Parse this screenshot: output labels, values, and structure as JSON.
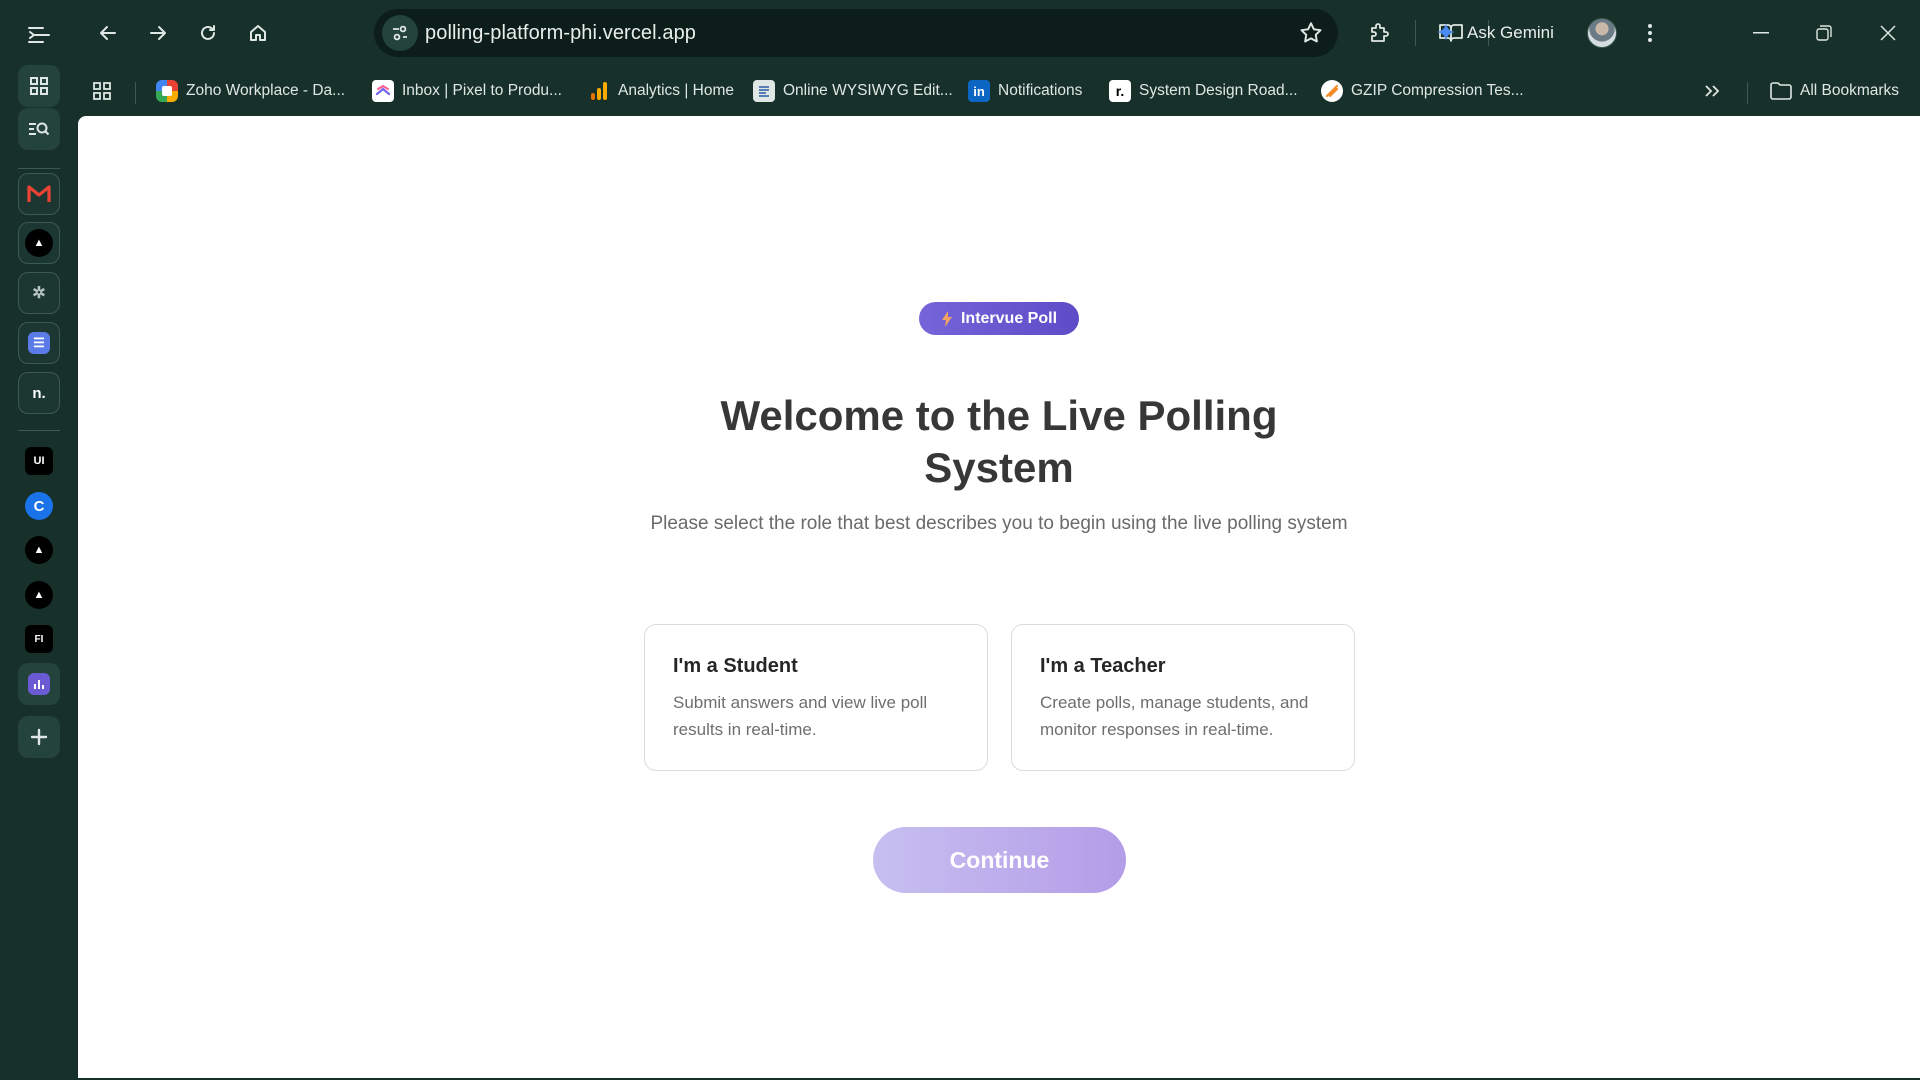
{
  "browser": {
    "url": "polling-platform-phi.vercel.app",
    "ask_gemini_label": "Ask Gemini",
    "all_bookmarks_label": "All Bookmarks",
    "bookmarks": [
      {
        "label": "Zoho Workplace - Da...",
        "icon": "zoho-icon"
      },
      {
        "label": "Inbox | Pixel to Produ...",
        "icon": "clickup-icon"
      },
      {
        "label": "Analytics | Home",
        "icon": "analytics-icon"
      },
      {
        "label": "Online WYSIWYG Edit...",
        "icon": "document-icon"
      },
      {
        "label": "Notifications",
        "icon": "linkedin-icon"
      },
      {
        "label": "System Design Road...",
        "icon": "roadmap-icon"
      },
      {
        "label": "GZIP Compression Tes...",
        "icon": "gzip-icon"
      }
    ]
  },
  "sidebar": {
    "apps": [
      {
        "name": "gmail-icon",
        "glyph": "M"
      },
      {
        "name": "triangle-app-icon",
        "glyph": "▲"
      },
      {
        "name": "spark-app-icon",
        "glyph": "✲"
      },
      {
        "name": "list-app-icon",
        "glyph": "☰"
      },
      {
        "name": "notion-style-app-icon",
        "glyph": "n."
      },
      {
        "name": "ui-app-icon",
        "glyph": "UI"
      },
      {
        "name": "c-app-icon",
        "glyph": "C"
      },
      {
        "name": "triangle-app-icon-2",
        "glyph": "▲"
      },
      {
        "name": "triangle-app-icon-3",
        "glyph": "▲"
      },
      {
        "name": "fi-app-icon",
        "glyph": "FI"
      },
      {
        "name": "bar-chart-app-icon",
        "glyph": "▮"
      }
    ]
  },
  "page": {
    "badge_label": "Intervue Poll",
    "title_prefix": "Welcome to the ",
    "title_bold": "Live Polling System",
    "subtitle": "Please select the role that best describes you to begin using the live polling system",
    "roles": [
      {
        "title": "I'm a Student",
        "description": "Submit answers and view live poll results in real-time."
      },
      {
        "title": "I'm a Teacher",
        "description": "Create polls, manage students, and monitor responses in real-time."
      }
    ],
    "continue_label": "Continue"
  },
  "colors": {
    "chrome_bg": "#17302a",
    "badge_purple": "#6a5ad3",
    "continue_disabled": "#bfb3ee"
  }
}
